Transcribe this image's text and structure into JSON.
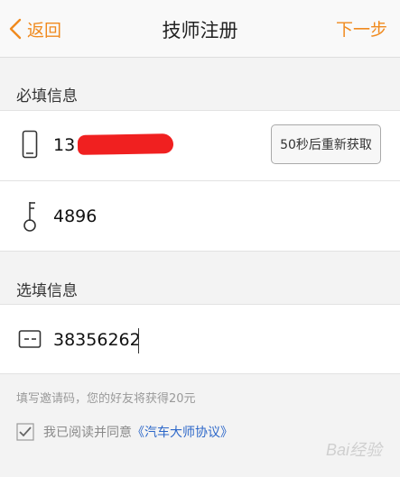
{
  "header": {
    "back_label": "返回",
    "title": "技师注册",
    "next_label": "下一步"
  },
  "required_section": {
    "label": "必填信息",
    "phone": {
      "value": "13",
      "icon": "phone-icon"
    },
    "resend_button_label": "50秒后重新获取",
    "code": {
      "value": "4896",
      "icon": "key-icon"
    }
  },
  "optional_section": {
    "label": "选填信息",
    "invite": {
      "value": "38356262",
      "icon": "card-icon"
    }
  },
  "hint_text": "填写邀请码，您的好友将获得20元",
  "agreement": {
    "checked": true,
    "prefix": "我已阅读并同意",
    "link_label": "《汽车大师协议》"
  },
  "watermark": "Bai经验",
  "colors": {
    "accent": "#f08a1e",
    "link": "#2c67c9",
    "background": "#f3f3f3"
  }
}
